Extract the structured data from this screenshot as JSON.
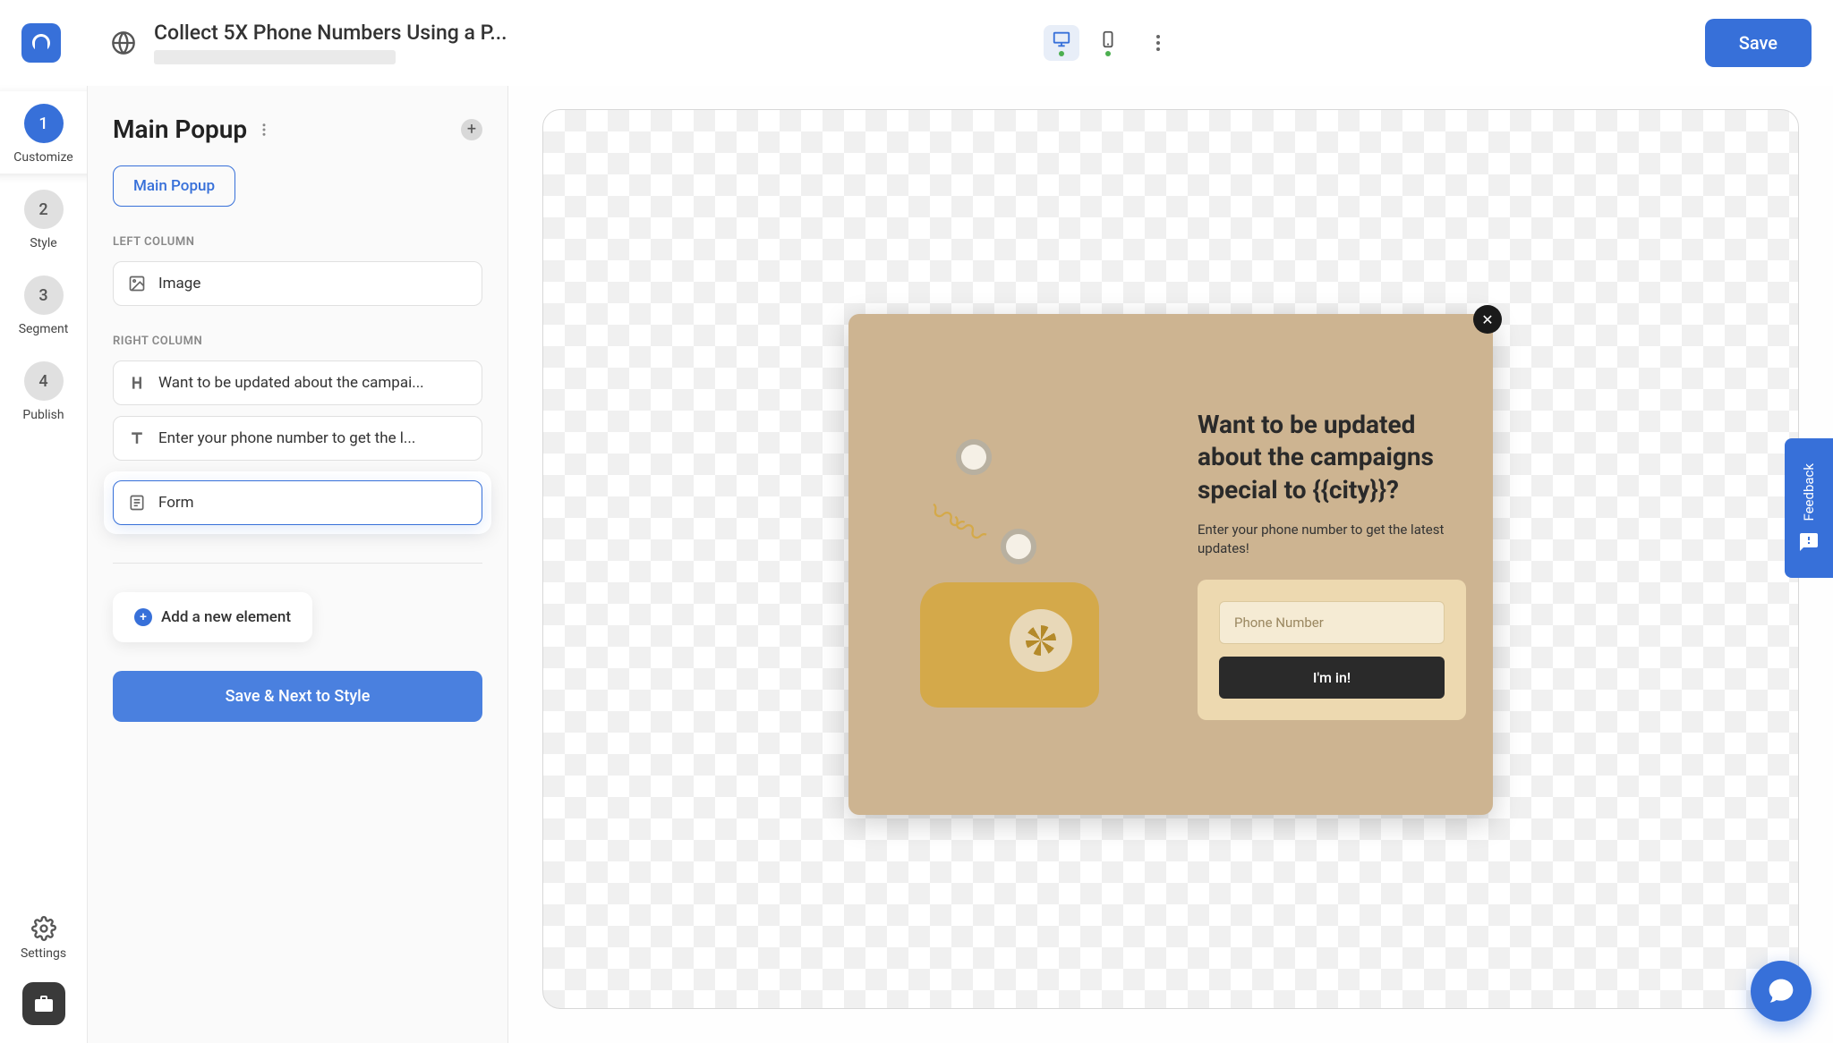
{
  "header": {
    "title": "Collect 5X Phone Numbers Using a P...",
    "save_label": "Save"
  },
  "rail": {
    "items": [
      {
        "num": "1",
        "label": "Customize"
      },
      {
        "num": "2",
        "label": "Style"
      },
      {
        "num": "3",
        "label": "Segment"
      },
      {
        "num": "4",
        "label": "Publish"
      }
    ],
    "settings_label": "Settings"
  },
  "panel": {
    "title": "Main Popup",
    "chip_label": "Main Popup",
    "left_column_label": "LEFT COLUMN",
    "right_column_label": "RIGHT COLUMN",
    "left_elements": [
      {
        "label": "Image"
      }
    ],
    "right_elements": [
      {
        "label": "Want to be updated about the campai..."
      },
      {
        "label": "Enter your phone number to get the l..."
      },
      {
        "label": "Form"
      }
    ],
    "add_element_label": "Add a new element",
    "save_next_label": "Save & Next to Style"
  },
  "popup": {
    "heading": "Want to be updated about the campaigns special to {{city}}?",
    "subtext": "Enter your phone number to get the latest updates!",
    "input_placeholder": "Phone Number",
    "submit_label": "I'm in!"
  },
  "feedback": {
    "label": "Feedback"
  }
}
